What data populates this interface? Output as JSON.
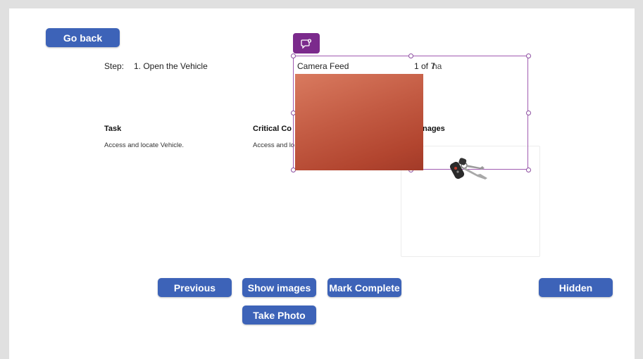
{
  "buttons": {
    "go_back": "Go back",
    "previous": "Previous",
    "show_images": "Show images",
    "mark_complete": "Mark Complete",
    "hidden": "Hidden",
    "take_photo": "Take Photo"
  },
  "step": {
    "label": "Step:",
    "value": "1. Open the Vehicle"
  },
  "task": {
    "heading": "Task",
    "text": "Access and locate Vehicle."
  },
  "critical": {
    "heading": "Critical Co",
    "text": "Access and lo"
  },
  "images": {
    "heading": "nages"
  },
  "camera": {
    "label": "Camera Feed",
    "counter": "1 of 7",
    "counter_overlay": "ha"
  },
  "colors": {
    "button_blue": "#3d63b8",
    "selection_purple": "#a05ab0",
    "comment_purple": "#7b2a8c",
    "camera_orange": "#c35b43"
  },
  "icons": {
    "comment": "comment-add-icon",
    "keys": "car-keys-icon"
  }
}
